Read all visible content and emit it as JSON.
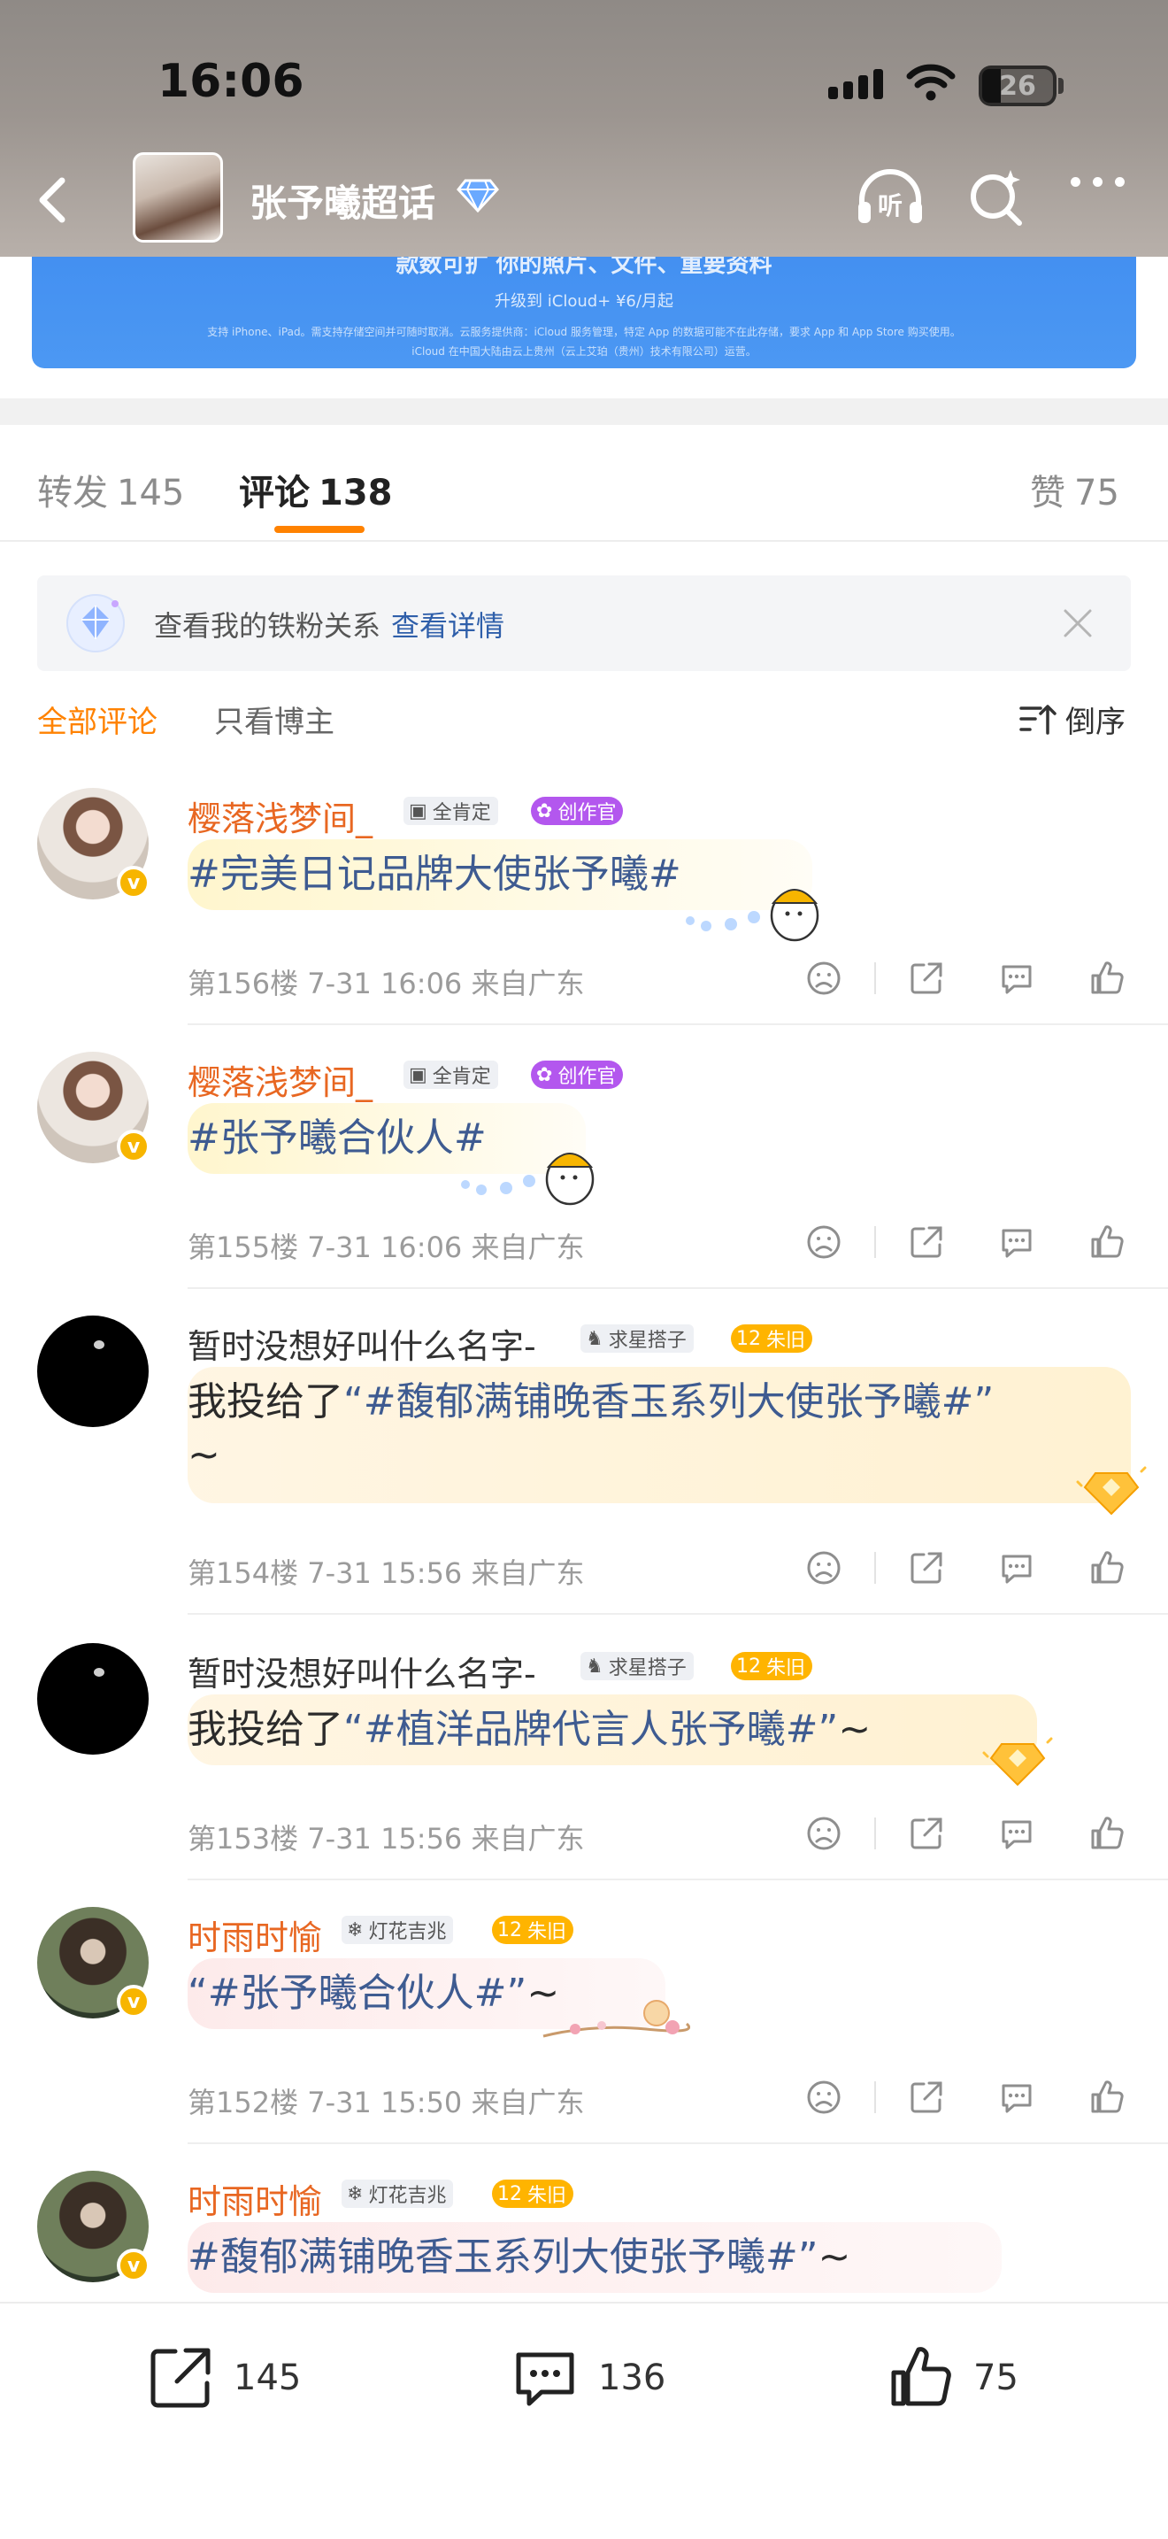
{
  "status": {
    "time": "16:06",
    "battery": "26",
    "battery_level": 0.26
  },
  "header": {
    "title": "张予曦超话"
  },
  "ad": {
    "line1": "款数可扩 你的照片、文件、重要资料",
    "line2": "升级到 iCloud+ ¥6/月起",
    "line3": "支持 iPhone、iPad。需支持存储空间并可随时取消。云服务提供商：iCloud 服务管理，特定 App 的数据可能不在此存储，要求 App 和 App Store 购买使用。",
    "line4": "iCloud 在中国大陆由云上贵州（云上艾珀（贵州）技术有限公司）运营。"
  },
  "tabs": [
    {
      "label": "转发",
      "count": "145"
    },
    {
      "label": "评论",
      "count": "138"
    },
    {
      "label": "赞",
      "count": "75"
    }
  ],
  "fan": {
    "text": "查看我的铁粉关系",
    "link": "查看详情"
  },
  "filters": {
    "all": "全部评论",
    "author_only": "只看博主",
    "sort": "倒序"
  },
  "comments": [
    {
      "name": "樱落浅梦间_",
      "tags": [
        "全肯定",
        "创作官"
      ],
      "content": "#完美日记品牌大使张予曦#",
      "floor": "第156楼",
      "time": "7-31 16:06",
      "location": "来自广东"
    },
    {
      "name": "樱落浅梦间_",
      "tags": [
        "全肯定",
        "创作官"
      ],
      "content": "#张予曦合伙人#",
      "floor": "第155楼",
      "time": "7-31 16:06",
      "location": "来自广东"
    },
    {
      "name": "暂时没想好叫什么名字-",
      "tags": [
        "求星搭子",
        "12",
        "朱旧"
      ],
      "prefix": "我投给了",
      "content_line1": "“#馥郁满铺晚香玉系列大使张予曦#”",
      "content_line2": "~",
      "floor": "第154楼",
      "time": "7-31 15:56",
      "location": "来自广东"
    },
    {
      "name": "暂时没想好叫什么名字-",
      "tags": [
        "求星搭子",
        "12",
        "朱旧"
      ],
      "prefix": "我投给了",
      "content": "“#植洋品牌代言人张予曦#”",
      "suffix": "~",
      "floor": "第153楼",
      "time": "7-31 15:56",
      "location": "来自广东"
    },
    {
      "name": "时雨时愉",
      "tags": [
        "灯花吉兆",
        "12",
        "朱旧"
      ],
      "content": "“#张予曦合伙人#”",
      "suffix": "~",
      "floor": "第152楼",
      "time": "7-31 15:50",
      "location": "来自广东"
    },
    {
      "name": "时雨时愉",
      "tags": [
        "灯花吉兆",
        "12",
        "朱旧"
      ],
      "content": "#馥郁满铺晚香玉系列大使张予曦#”",
      "suffix": "~"
    }
  ],
  "bottom": {
    "repost": "145",
    "comment": "136",
    "like": "75"
  },
  "colors": {
    "accent": "#ff8200",
    "topic": "#3e5b91",
    "username": "#e86722"
  }
}
